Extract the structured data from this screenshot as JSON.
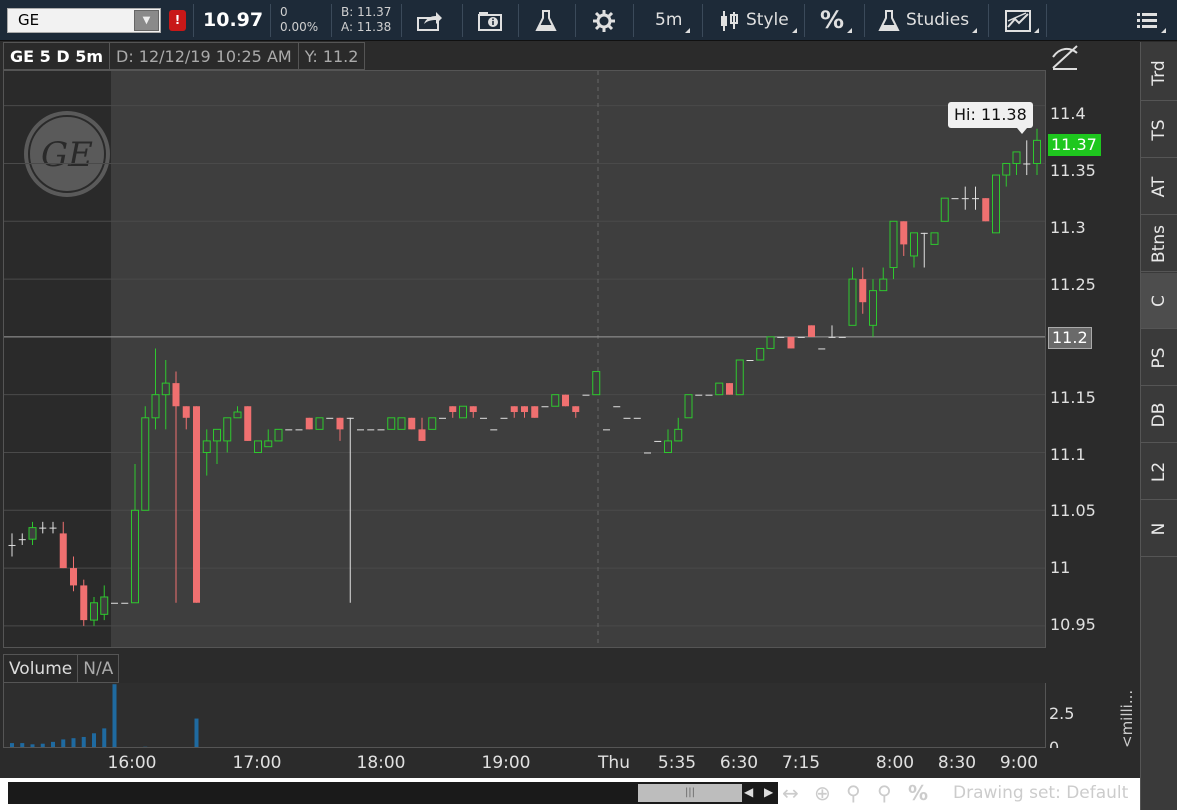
{
  "toolbar": {
    "symbol": "GE",
    "alert_badge": "!",
    "last_price": "10.97",
    "net_change": "0",
    "pct_change": "0.00%",
    "bid": "B: 11.37",
    "ask": "A: 11.38",
    "aggregation": "5m",
    "style_label": "Style",
    "percent_label": "%",
    "studies_label": "Studies"
  },
  "chart_header": {
    "title": "GE 5 D 5m",
    "date": "D: 12/12/19 10:25 AM",
    "y_value": "Y: 11.2"
  },
  "price_axis": {
    "ticks": [
      "11.4",
      "11.35",
      "11.3",
      "11.25",
      "11.2",
      "11.15",
      "11.1",
      "11.05",
      "11",
      "10.95"
    ],
    "last_tag": "11.37",
    "crosshair_tag": "11.2",
    "hi_label": "Hi: 11.38"
  },
  "volume": {
    "header": "Volume",
    "value": "N/A",
    "axis_tick": "2.5",
    "axis_zero": "0",
    "units": "<milli..."
  },
  "time_axis": [
    "16:00",
    "17:00",
    "18:00",
    "19:00",
    "Thu",
    "5:35",
    "6:30",
    "7:15",
    "8:00",
    "8:30",
    "9:00"
  ],
  "sidebar": [
    "Trd",
    "TS",
    "AT",
    "Btns",
    "C",
    "PS",
    "DB",
    "L2",
    "N"
  ],
  "bottom_bar": {
    "drawing_set": "Drawing set: Default"
  },
  "colors": {
    "up": "#2ec82e",
    "down": "#f07070",
    "doji": "#e0e0e0",
    "volume": "#1f6aa0",
    "last_tag": "#1ec71e"
  },
  "chart_data": {
    "type": "candlestick",
    "ylim": [
      10.93,
      11.43
    ],
    "candles": [
      {
        "o": 11.02,
        "h": 11.03,
        "l": 11.01,
        "c": 11.02
      },
      {
        "o": 11.025,
        "h": 11.03,
        "l": 11.02,
        "c": 11.025
      },
      {
        "o": 11.025,
        "h": 11.04,
        "l": 11.02,
        "c": 11.035
      },
      {
        "o": 11.035,
        "h": 11.04,
        "l": 11.03,
        "c": 11.035
      },
      {
        "o": 11.035,
        "h": 11.04,
        "l": 11.03,
        "c": 11.035
      },
      {
        "o": 11.03,
        "h": 11.04,
        "l": 11.0,
        "c": 11.0
      },
      {
        "o": 11.0,
        "h": 11.01,
        "l": 10.98,
        "c": 10.985
      },
      {
        "o": 10.985,
        "h": 10.99,
        "l": 10.95,
        "c": 10.955
      },
      {
        "o": 10.955,
        "h": 10.975,
        "l": 10.95,
        "c": 10.97
      },
      {
        "o": 10.96,
        "h": 10.985,
        "l": 10.955,
        "c": 10.975
      },
      {
        "o": 10.97,
        "h": 10.97,
        "l": 10.97,
        "c": 10.97
      },
      {
        "o": 10.97,
        "h": 10.97,
        "l": 10.97,
        "c": 10.97
      },
      {
        "o": 10.97,
        "h": 11.09,
        "l": 10.97,
        "c": 11.05
      },
      {
        "o": 11.05,
        "h": 11.14,
        "l": 11.05,
        "c": 11.13
      },
      {
        "o": 11.13,
        "h": 11.19,
        "l": 11.12,
        "c": 11.15
      },
      {
        "o": 11.15,
        "h": 11.18,
        "l": 11.12,
        "c": 11.16
      },
      {
        "o": 11.16,
        "h": 11.17,
        "l": 10.97,
        "c": 11.14
      },
      {
        "o": 11.14,
        "h": 11.14,
        "l": 11.12,
        "c": 11.13
      },
      {
        "o": 11.14,
        "h": 11.14,
        "l": 10.97,
        "c": 10.97
      },
      {
        "o": 11.1,
        "h": 11.12,
        "l": 11.08,
        "c": 11.11
      },
      {
        "o": 11.11,
        "h": 11.12,
        "l": 11.09,
        "c": 11.12
      },
      {
        "o": 11.11,
        "h": 11.13,
        "l": 11.1,
        "c": 11.13
      },
      {
        "o": 11.13,
        "h": 11.14,
        "l": 11.13,
        "c": 11.135
      },
      {
        "o": 11.14,
        "h": 11.14,
        "l": 11.11,
        "c": 11.11
      },
      {
        "o": 11.1,
        "h": 11.11,
        "l": 11.1,
        "c": 11.11
      },
      {
        "o": 11.105,
        "h": 11.12,
        "l": 11.105,
        "c": 11.11
      },
      {
        "o": 11.11,
        "h": 11.12,
        "l": 11.11,
        "c": 11.12
      },
      {
        "o": 11.12,
        "h": 11.12,
        "l": 11.12,
        "c": 11.12
      },
      {
        "o": 11.12,
        "h": 11.12,
        "l": 11.12,
        "c": 11.12
      },
      {
        "o": 11.13,
        "h": 11.13,
        "l": 11.12,
        "c": 11.12
      },
      {
        "o": 11.12,
        "h": 11.13,
        "l": 11.12,
        "c": 11.13
      },
      {
        "o": 11.13,
        "h": 11.13,
        "l": 11.13,
        "c": 11.13
      },
      {
        "o": 11.13,
        "h": 11.13,
        "l": 11.11,
        "c": 11.12
      },
      {
        "o": 11.13,
        "h": 11.13,
        "l": 10.97,
        "c": 11.13
      },
      {
        "o": 11.12,
        "h": 11.12,
        "l": 11.12,
        "c": 11.12
      },
      {
        "o": 11.12,
        "h": 11.12,
        "l": 11.12,
        "c": 11.12
      },
      {
        "o": 11.12,
        "h": 11.12,
        "l": 11.12,
        "c": 11.12
      },
      {
        "o": 11.12,
        "h": 11.13,
        "l": 11.12,
        "c": 11.13
      },
      {
        "o": 11.12,
        "h": 11.13,
        "l": 11.12,
        "c": 11.13
      },
      {
        "o": 11.13,
        "h": 11.13,
        "l": 11.12,
        "c": 11.12
      },
      {
        "o": 11.12,
        "h": 11.13,
        "l": 11.11,
        "c": 11.11
      },
      {
        "o": 11.12,
        "h": 11.13,
        "l": 11.12,
        "c": 11.13
      },
      {
        "o": 11.13,
        "h": 11.13,
        "l": 11.13,
        "c": 11.13
      },
      {
        "o": 11.14,
        "h": 11.14,
        "l": 11.13,
        "c": 11.135
      },
      {
        "o": 11.13,
        "h": 11.14,
        "l": 11.13,
        "c": 11.14
      },
      {
        "o": 11.14,
        "h": 11.14,
        "l": 11.13,
        "c": 11.135
      },
      {
        "o": 11.13,
        "h": 11.13,
        "l": 11.13,
        "c": 11.13
      },
      {
        "o": 11.12,
        "h": 11.12,
        "l": 11.12,
        "c": 11.12
      },
      {
        "o": 11.13,
        "h": 11.13,
        "l": 11.13,
        "c": 11.13
      },
      {
        "o": 11.14,
        "h": 11.14,
        "l": 11.13,
        "c": 11.135
      },
      {
        "o": 11.14,
        "h": 11.14,
        "l": 11.13,
        "c": 11.135
      },
      {
        "o": 11.14,
        "h": 11.14,
        "l": 11.13,
        "c": 11.13
      },
      {
        "o": 11.14,
        "h": 11.14,
        "l": 11.14,
        "c": 11.14
      },
      {
        "o": 11.14,
        "h": 11.15,
        "l": 11.14,
        "c": 11.15
      },
      {
        "o": 11.15,
        "h": 11.15,
        "l": 11.14,
        "c": 11.14
      },
      {
        "o": 11.14,
        "h": 11.14,
        "l": 11.13,
        "c": 11.135
      },
      {
        "o": 11.15,
        "h": 11.15,
        "l": 11.15,
        "c": 11.15
      },
      {
        "o": 11.15,
        "h": 11.17,
        "l": 11.15,
        "c": 11.17
      },
      {
        "o": 11.12,
        "h": 11.12,
        "l": 11.12,
        "c": 11.12
      },
      {
        "o": 11.14,
        "h": 11.14,
        "l": 11.14,
        "c": 11.14
      },
      {
        "o": 11.13,
        "h": 11.13,
        "l": 11.13,
        "c": 11.13
      },
      {
        "o": 11.13,
        "h": 11.13,
        "l": 11.13,
        "c": 11.13
      },
      {
        "o": 11.1,
        "h": 11.1,
        "l": 11.1,
        "c": 11.1
      },
      {
        "o": 11.11,
        "h": 11.11,
        "l": 11.11,
        "c": 11.11
      },
      {
        "o": 11.1,
        "h": 11.12,
        "l": 11.1,
        "c": 11.11
      },
      {
        "o": 11.11,
        "h": 11.13,
        "l": 11.11,
        "c": 11.12
      },
      {
        "o": 11.13,
        "h": 11.15,
        "l": 11.13,
        "c": 11.15
      },
      {
        "o": 11.15,
        "h": 11.15,
        "l": 11.15,
        "c": 11.15
      },
      {
        "o": 11.15,
        "h": 11.15,
        "l": 11.15,
        "c": 11.15
      },
      {
        "o": 11.15,
        "h": 11.16,
        "l": 11.15,
        "c": 11.16
      },
      {
        "o": 11.16,
        "h": 11.16,
        "l": 11.15,
        "c": 11.15
      },
      {
        "o": 11.15,
        "h": 11.18,
        "l": 11.15,
        "c": 11.18
      },
      {
        "o": 11.18,
        "h": 11.18,
        "l": 11.18,
        "c": 11.18
      },
      {
        "o": 11.18,
        "h": 11.19,
        "l": 11.18,
        "c": 11.19
      },
      {
        "o": 11.19,
        "h": 11.2,
        "l": 11.19,
        "c": 11.2
      },
      {
        "o": 11.2,
        "h": 11.2,
        "l": 11.2,
        "c": 11.2
      },
      {
        "o": 11.2,
        "h": 11.2,
        "l": 11.19,
        "c": 11.19
      },
      {
        "o": 11.2,
        "h": 11.2,
        "l": 11.2,
        "c": 11.2
      },
      {
        "o": 11.21,
        "h": 11.21,
        "l": 11.2,
        "c": 11.2
      },
      {
        "o": 11.19,
        "h": 11.19,
        "l": 11.19,
        "c": 11.19
      },
      {
        "o": 11.2,
        "h": 11.21,
        "l": 11.2,
        "c": 11.2
      },
      {
        "o": 11.2,
        "h": 11.2,
        "l": 11.2,
        "c": 11.2
      },
      {
        "o": 11.21,
        "h": 11.26,
        "l": 11.21,
        "c": 11.25
      },
      {
        "o": 11.25,
        "h": 11.26,
        "l": 11.22,
        "c": 11.23
      },
      {
        "o": 11.21,
        "h": 11.25,
        "l": 11.2,
        "c": 11.24
      },
      {
        "o": 11.24,
        "h": 11.26,
        "l": 11.24,
        "c": 11.25
      },
      {
        "o": 11.26,
        "h": 11.3,
        "l": 11.25,
        "c": 11.3
      },
      {
        "o": 11.3,
        "h": 11.3,
        "l": 11.27,
        "c": 11.28
      },
      {
        "o": 11.27,
        "h": 11.29,
        "l": 11.26,
        "c": 11.29
      },
      {
        "o": 11.29,
        "h": 11.29,
        "l": 11.26,
        "c": 11.29
      },
      {
        "o": 11.28,
        "h": 11.29,
        "l": 11.28,
        "c": 11.29
      },
      {
        "o": 11.3,
        "h": 11.32,
        "l": 11.3,
        "c": 11.32
      },
      {
        "o": 11.32,
        "h": 11.32,
        "l": 11.32,
        "c": 11.32
      },
      {
        "o": 11.32,
        "h": 11.33,
        "l": 11.31,
        "c": 11.32
      },
      {
        "o": 11.32,
        "h": 11.33,
        "l": 11.31,
        "c": 11.32
      },
      {
        "o": 11.32,
        "h": 11.32,
        "l": 11.3,
        "c": 11.3
      },
      {
        "o": 11.29,
        "h": 11.34,
        "l": 11.29,
        "c": 11.34
      },
      {
        "o": 11.34,
        "h": 11.35,
        "l": 11.33,
        "c": 11.35
      },
      {
        "o": 11.35,
        "h": 11.36,
        "l": 11.34,
        "c": 11.36
      },
      {
        "o": 11.35,
        "h": 11.37,
        "l": 11.34,
        "c": 11.35
      },
      {
        "o": 11.35,
        "h": 11.38,
        "l": 11.34,
        "c": 11.37
      }
    ],
    "volume_bars": [
      {
        "i": 0,
        "v": 0.4
      },
      {
        "i": 1,
        "v": 0.4
      },
      {
        "i": 2,
        "v": 0.3
      },
      {
        "i": 3,
        "v": 0.35
      },
      {
        "i": 4,
        "v": 0.5
      },
      {
        "i": 5,
        "v": 0.7
      },
      {
        "i": 6,
        "v": 0.8
      },
      {
        "i": 7,
        "v": 0.9
      },
      {
        "i": 8,
        "v": 1.2
      },
      {
        "i": 9,
        "v": 1.6
      },
      {
        "i": 10,
        "v": 5.2
      },
      {
        "i": 13,
        "v": 0.1
      },
      {
        "i": 18,
        "v": 2.4
      }
    ],
    "volume_ylim": [
      0,
      5.3
    ]
  }
}
